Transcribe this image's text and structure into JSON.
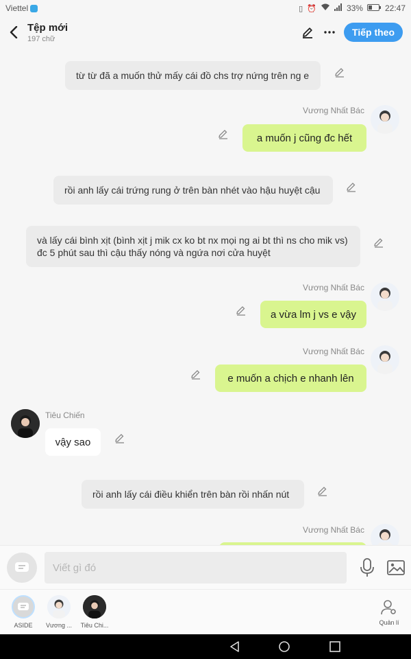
{
  "status": {
    "carrier": "Viettel",
    "battery": "33%",
    "time": "22:47"
  },
  "header": {
    "title": "Tệp mới",
    "subtitle": "197 chữ",
    "next_label": "Tiếp theo"
  },
  "messages": [
    {
      "type": "narration",
      "text": "từ từ đã a muốn thử mấy cái đồ chs trợ nứng trên ng e"
    },
    {
      "type": "right",
      "sender": "Vương Nhất Bác",
      "text": "a muốn j cũng đc hết"
    },
    {
      "type": "narration",
      "text": "rồi anh lấy cái trứng rung ở trên bàn nhét vào hậu huyệt cậu"
    },
    {
      "type": "narration",
      "text": "và lấy cái bình xịt (bình xịt j mik cx ko bt nx mọi ng ai bt thì ns cho mik vs) đc 5 phút sau thì cậu thấy nóng và ngứa nơi cửa huyệt"
    },
    {
      "type": "right",
      "sender": "Vương Nhất Bác",
      "text": "a vừa lm j vs e vậy"
    },
    {
      "type": "right",
      "sender": "Vương Nhất Bác",
      "text": "e muốn a chịch e nhanh lên"
    },
    {
      "type": "left",
      "sender": "Tiêu Chiến",
      "text": "vậy sao"
    },
    {
      "type": "narration",
      "text": "rồi anh lấy cái điều khiển trên bàn rồi nhấn nút"
    },
    {
      "type": "right",
      "sender": "Vương Nhất Bác",
      "text": ""
    }
  ],
  "composer": {
    "placeholder": "Viết gì đó"
  },
  "characters": [
    {
      "label": "ASIDE"
    },
    {
      "label": "Vương ..."
    },
    {
      "label": "Tiêu Chi..."
    }
  ],
  "manage_label": "Quản lí",
  "colors": {
    "accent": "#3d9cf0",
    "right_bubble": "#d9f58f",
    "narration_bg": "#ebebeb"
  }
}
